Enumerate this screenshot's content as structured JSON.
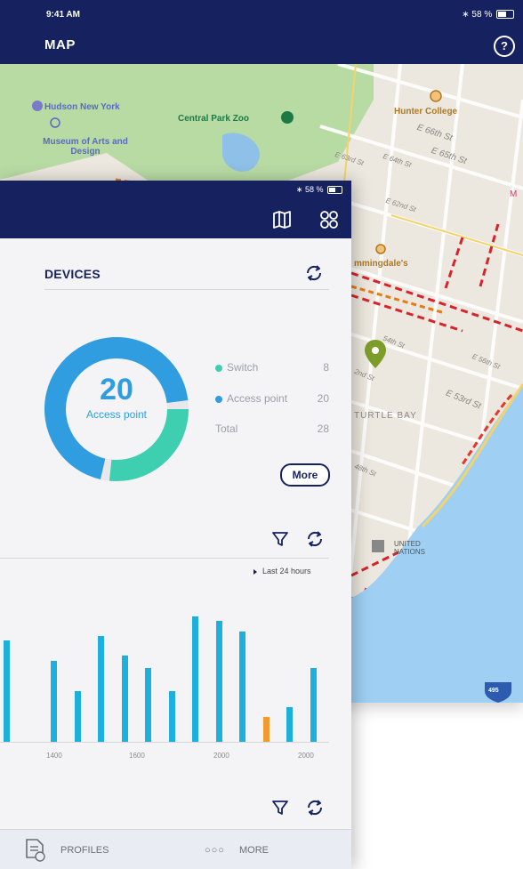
{
  "map_screen": {
    "status": {
      "time": "9:41 AM",
      "battery": "58 %"
    },
    "title": "MAP",
    "help_label": "?",
    "labels": {
      "hudson": "Hudson New York",
      "museum": "Museum of Arts and Design",
      "central_park_zoo": "Central Park Zoo",
      "hunter_college": "Hunter College",
      "e66": "E 66th St",
      "e65": "E 65th St",
      "e64": "E 64th St",
      "e63": "E 63rd St",
      "e62": "E 62nd St",
      "e56": "E 56th St",
      "e53": "E 53rd St",
      "bloomingdales": "mmingdale's",
      "turtle_bay": "TURTLE BAY",
      "un": "UNITED NATIONS",
      "i495": "495",
      "st54": "54th St",
      "st52": "2nd St",
      "st48": "48th St",
      "m": "M"
    }
  },
  "device_screen": {
    "status": {
      "battery": "58 %"
    },
    "devices": {
      "title": "DEVICES",
      "donut": {
        "center_value": "20",
        "center_label": "Access point",
        "switch": 8,
        "access_point": 20,
        "total": 28
      },
      "legend": [
        {
          "label": "Switch",
          "value": "8",
          "color": "#3ecfb0"
        },
        {
          "label": "Access point",
          "value": "20",
          "color": "#2f9de0"
        },
        {
          "label": "Total",
          "value": "28",
          "color": ""
        }
      ],
      "more_label": "More"
    },
    "chart": {
      "time_range": "Last 24 hours",
      "ticks": [
        "1400",
        "1600",
        "2000",
        "2000"
      ]
    },
    "tabs": {
      "profiles": "PROFILES",
      "more": "MORE",
      "more_glyph": "○○○"
    }
  },
  "colors": {
    "header": "#16215f",
    "switch": "#3ecfb0",
    "access_point": "#2f9de0",
    "bar": "#1eb0dc",
    "bar_warning": "#f19b2f"
  },
  "chart_data": {
    "type": "bar",
    "title": "",
    "values": [
      112,
      0,
      90,
      56,
      117,
      96,
      82,
      56,
      139,
      134,
      122,
      28,
      38,
      82
    ],
    "highlight_index": 11,
    "x_ticks": [
      "1400",
      "1600",
      "2000",
      "2000"
    ],
    "legend_text": "Last 24 hours"
  }
}
